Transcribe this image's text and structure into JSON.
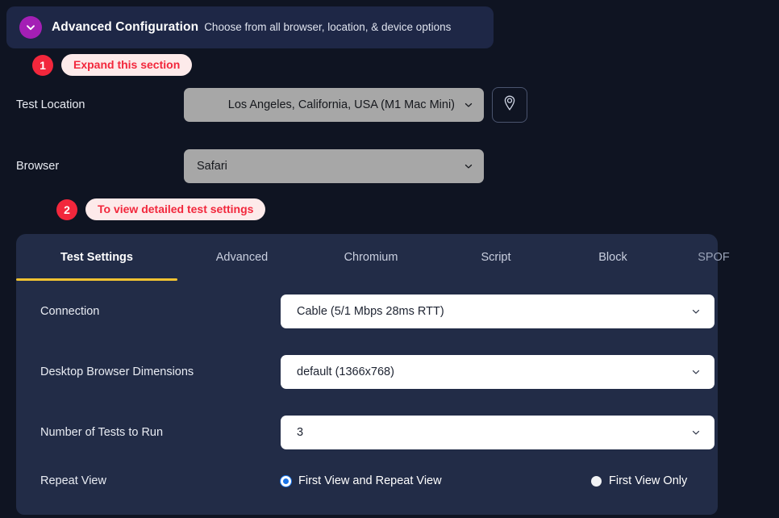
{
  "header": {
    "toggle_icon": "chevron-down-icon",
    "title": "Advanced Configuration",
    "subtitle": "Choose from all browser, location, & device options",
    "accent_purple": "#a41fb5",
    "card_bg": "#1e2746"
  },
  "annotations": [
    {
      "number": "1",
      "text": "Expand this section"
    },
    {
      "number": "2",
      "text": "To view detailed test settings"
    }
  ],
  "annotation_colors": {
    "badge_bg": "#f2273c",
    "pill_bg": "#fdeaea",
    "pill_text": "#f2273c"
  },
  "top_form": {
    "location": {
      "label": "Test Location",
      "value": "Los Angeles, California, USA (M1 Mac Mini)",
      "caret_icon": "chevron-down-icon",
      "pin_button_icon": "map-pin-icon"
    },
    "browser": {
      "label": "Browser",
      "value": "Safari",
      "caret_icon": "chevron-down-icon"
    }
  },
  "tabs": [
    {
      "id": "test-settings",
      "label": "Test Settings",
      "active": true
    },
    {
      "id": "advanced",
      "label": "Advanced",
      "active": false
    },
    {
      "id": "chromium",
      "label": "Chromium",
      "active": false
    },
    {
      "id": "script",
      "label": "Script",
      "active": false
    },
    {
      "id": "block",
      "label": "Block",
      "active": false
    },
    {
      "id": "spof",
      "label": "SPOF",
      "active": false
    }
  ],
  "tab_accent": "#f0c232",
  "settings": {
    "connection": {
      "label": "Connection",
      "value": "Cable (5/1 Mbps 28ms RTT)",
      "caret_icon": "chevron-down-icon"
    },
    "dimensions": {
      "label": "Desktop Browser Dimensions",
      "value": "default (1366x768)",
      "caret_icon": "chevron-down-icon"
    },
    "tests_to_run": {
      "label": "Number of Tests to Run",
      "value": "3",
      "caret_icon": "chevron-down-icon"
    },
    "repeat_view": {
      "label": "Repeat View",
      "options": [
        {
          "label": "First View and Repeat View",
          "selected": true
        },
        {
          "label": "First View Only",
          "selected": false
        }
      ]
    }
  },
  "colors": {
    "page_bg": "#0f1422",
    "panel_bg": "#222c47",
    "gray_select_bg": "#a7a7a7",
    "radio_selected": "#1a73e8"
  }
}
